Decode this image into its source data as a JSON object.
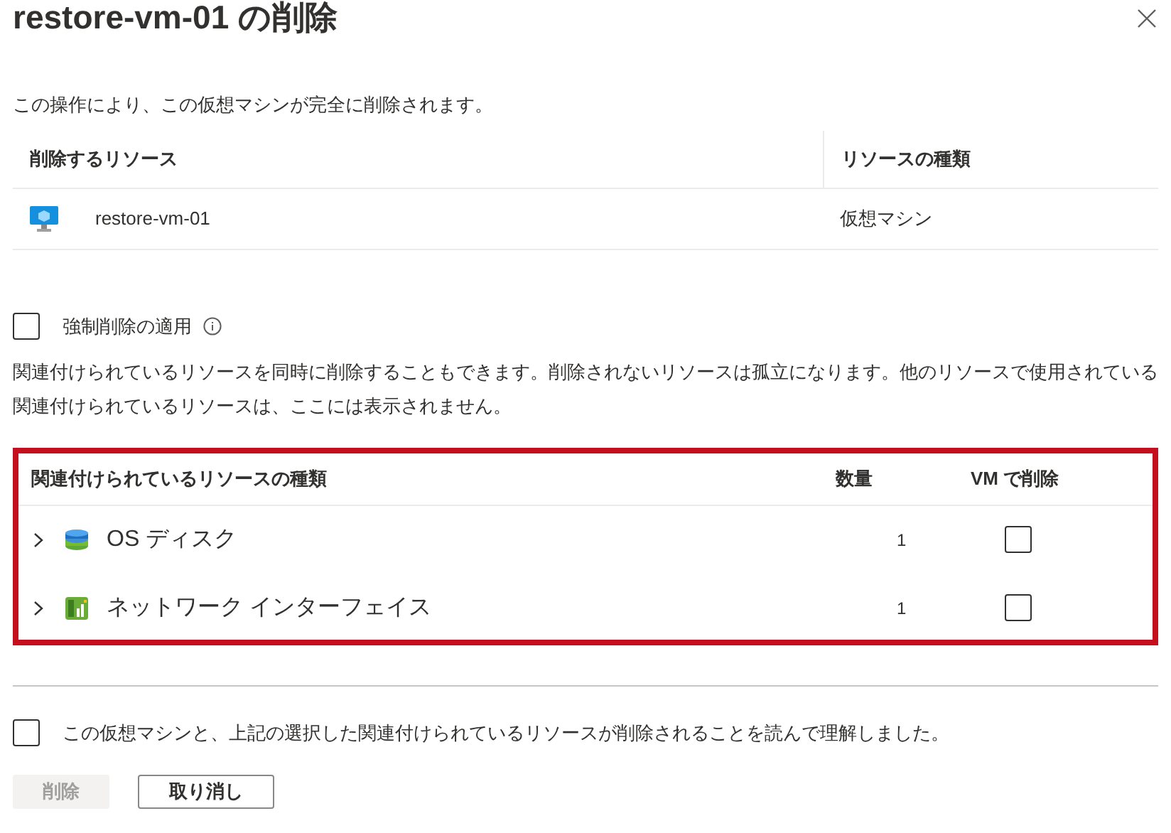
{
  "dialog": {
    "title": "restore-vm-01 の削除",
    "description": "この操作により、この仮想マシンが完全に削除されます。"
  },
  "resources_table": {
    "columns": [
      "削除するリソース",
      "リソースの種類"
    ],
    "rows": [
      {
        "name": "restore-vm-01",
        "type": "仮想マシン"
      }
    ]
  },
  "force_delete": {
    "label": "強制削除の適用",
    "checked": false
  },
  "note": "関連付けられているリソースを同時に削除することもできます。削除されないリソースは孤立になります。他のリソースで使用されている関連付けられているリソースは、ここには表示されません。",
  "associated_table": {
    "columns": [
      "関連付けられているリソースの種類",
      "数量",
      "VM で削除"
    ],
    "rows": [
      {
        "kind": "disk",
        "name": "OS ディスク",
        "count": "1",
        "expanded": false,
        "checked": false
      },
      {
        "kind": "nic",
        "name": "ネットワーク インターフェイス",
        "count": "1",
        "expanded": false,
        "checked": false
      }
    ]
  },
  "confirm": {
    "label": "この仮想マシンと、上記の選択した関連付けられているリソースが削除されることを読んで理解しました。",
    "checked": false
  },
  "buttons": [
    {
      "label": "削除",
      "disabled": true
    },
    {
      "label": "取り消し",
      "disabled": false
    }
  ]
}
